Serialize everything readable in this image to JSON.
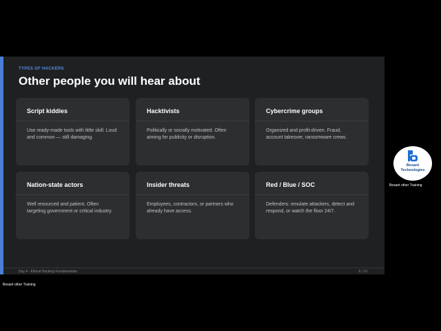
{
  "slide": {
    "eyebrow": "TYPES OF HACKERS",
    "title": "Other people you will hear about",
    "cards": [
      {
        "title": "Script kiddies",
        "description": "Use ready-made tools with little skill. Loud and common — still damaging."
      },
      {
        "title": "Hacktivists",
        "description": "Politically or socially motivated. Often aiming for publicity or disruption."
      },
      {
        "title": "Cybercrime groups",
        "description": "Organized and profit-driven. Fraud, account takeover, ransomware crews."
      },
      {
        "title": "Nation-state actors",
        "description": "Well resourced and patient. Often targeting government or critical industry."
      },
      {
        "title": "Insider threats",
        "description": "Employees, contractors, or partners who already have access."
      },
      {
        "title": "Red / Blue / SOC",
        "description": "Defenders: emulate attackers, detect and respond, or watch the floor 24/7."
      }
    ],
    "footer": {
      "left": "Day 4 · Ethical Hacking Fundamentals",
      "right": "6 / 10"
    }
  },
  "presenter": {
    "logo_line1": "Besant",
    "logo_line2": "Technologies",
    "caption": "Besant other Training"
  },
  "self_view": {
    "caption": "Besant other Training"
  },
  "colors": {
    "accent": "#4a7fd6",
    "eyebrow": "#5b8de0",
    "slide_bg": "#1f2022",
    "card_bg": "#2d2e30",
    "logo_blue": "#1a4c8c"
  }
}
